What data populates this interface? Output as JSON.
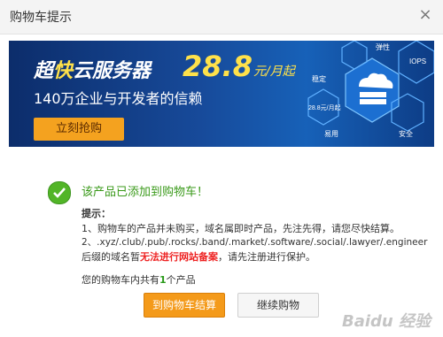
{
  "dialog": {
    "title": "购物车提示",
    "close_glyph": "×"
  },
  "banner": {
    "headline_prefix": "超",
    "headline_fast": "快",
    "headline_suffix": "云服务器",
    "price": "28.8",
    "unit": "元/月起",
    "subtitle": "140万企业与开发者的信赖",
    "cta_label": "立刻抢购",
    "badges": [
      "弹性",
      "IOPS",
      "稳定",
      "28.8元/月起",
      "易用",
      "安全"
    ]
  },
  "notice": {
    "success_text": "该产品已添加到购物车！",
    "tips_title": "提示：",
    "tip1": "1、购物车的产品并未购买，域名属即时产品，先注先得，请您尽快结算。",
    "tip2": "2、.xyz/.club/.pub/.rocks/.band/.market/.software/.social/.lawyer/.engineer",
    "tip3_prefix": "后缀的域名暂",
    "tip3_highlight": "无法进行网站备案",
    "tip3_suffix": "，请先注册进行保护。",
    "cart_prefix": "您的购物车内共有",
    "cart_count": "1",
    "cart_suffix": "个产品"
  },
  "buttons": {
    "checkout": "到购物车结算",
    "continue": "继续购物"
  },
  "watermark": "Baidu 经验",
  "colors": {
    "accent_orange": "#f49a1a",
    "success_green": "#3a9a1a",
    "highlight_red": "#e22222",
    "banner_blue": "#174a9a"
  },
  "icons": [
    "close-icon",
    "check-circle-icon",
    "cloud-server-icon"
  ]
}
